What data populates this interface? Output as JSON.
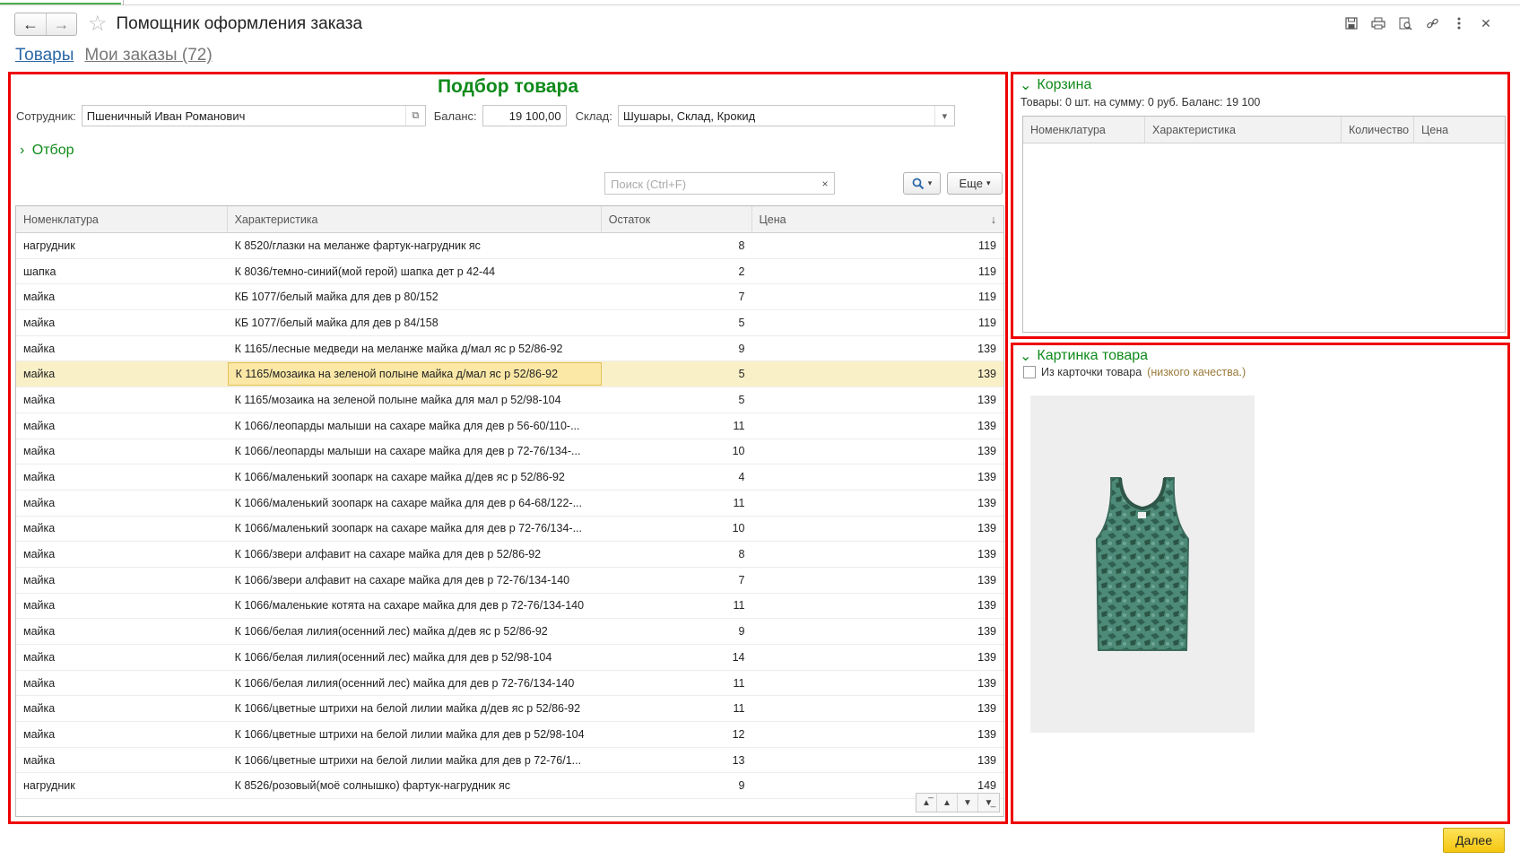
{
  "window": {
    "title": "Помощник оформления заказа",
    "back_icon": "arrow-left-icon",
    "forward_icon": "arrow-right-icon",
    "favorite_icon": "star-icon",
    "tools": [
      "save-icon",
      "print-icon",
      "preview-icon",
      "link-icon",
      "more-vertical-icon",
      "close-icon"
    ]
  },
  "tabs": {
    "products": "Товары",
    "orders": "Мои заказы (72)"
  },
  "selection": {
    "title": "Подбор товара",
    "employee_label": "Сотрудник:",
    "employee_value": "Пшеничный Иван Романович",
    "balance_label": "Баланс:",
    "balance_value": "19 100,00",
    "warehouse_label": "Склад:",
    "warehouse_value": "Шушары, Склад, Крокид",
    "filter_label": "Отбор",
    "search_placeholder": "Поиск (Ctrl+F)",
    "more_label": "Еще",
    "columns": [
      "Номенклатура",
      "Характеристика",
      "Остаток",
      "Цена"
    ],
    "sort_indicator": "↓",
    "rows": [
      {
        "name": "нагрудник",
        "char": "К 8520/глазки на меланже фартук-нагрудник яс",
        "stock": "8",
        "price": "119"
      },
      {
        "name": "шапка",
        "char": "К 8036/темно-синий(мой герой) шапка дет р 42-44",
        "stock": "2",
        "price": "119"
      },
      {
        "name": "майка",
        "char": "КБ 1077/белый майка для дев р 80/152",
        "stock": "7",
        "price": "119"
      },
      {
        "name": "майка",
        "char": "КБ 1077/белый майка для дев р 84/158",
        "stock": "5",
        "price": "119"
      },
      {
        "name": "майка",
        "char": "К 1165/лесные медведи на меланже майка д/мал яс р 52/86-92",
        "stock": "9",
        "price": "139"
      },
      {
        "name": "майка",
        "char": "К 1165/мозаика на зеленой полыне майка д/мал яс р 52/86-92",
        "stock": "5",
        "price": "139",
        "selected": true
      },
      {
        "name": "майка",
        "char": "К 1165/мозаика на зеленой полыне майка для мал р 52/98-104",
        "stock": "5",
        "price": "139"
      },
      {
        "name": "майка",
        "char": "К 1066/леопарды малыши на сахаре майка для дев р 56-60/110-...",
        "stock": "11",
        "price": "139"
      },
      {
        "name": "майка",
        "char": "К 1066/леопарды малыши на сахаре майка для дев р 72-76/134-...",
        "stock": "10",
        "price": "139"
      },
      {
        "name": "майка",
        "char": "К 1066/маленький зоопарк на сахаре майка д/дев яс р 52/86-92",
        "stock": "4",
        "price": "139"
      },
      {
        "name": "майка",
        "char": "К 1066/маленький зоопарк на сахаре майка для дев р 64-68/122-...",
        "stock": "11",
        "price": "139"
      },
      {
        "name": "майка",
        "char": "К 1066/маленький зоопарк на сахаре майка для дев р 72-76/134-...",
        "stock": "10",
        "price": "139"
      },
      {
        "name": "майка",
        "char": "К 1066/звери алфавит на сахаре майка для дев р 52/86-92",
        "stock": "8",
        "price": "139"
      },
      {
        "name": "майка",
        "char": "К 1066/звери алфавит на сахаре майка для дев р 72-76/134-140",
        "stock": "7",
        "price": "139"
      },
      {
        "name": "майка",
        "char": "К 1066/маленькие котята на сахаре майка для дев р 72-76/134-140",
        "stock": "11",
        "price": "139"
      },
      {
        "name": "майка",
        "char": "К 1066/белая лилия(осенний лес) майка д/дев яс р 52/86-92",
        "stock": "9",
        "price": "139"
      },
      {
        "name": "майка",
        "char": "К 1066/белая лилия(осенний лес) майка для дев р 52/98-104",
        "stock": "14",
        "price": "139"
      },
      {
        "name": "майка",
        "char": "К 1066/белая лилия(осенний лес) майка для дев р 72-76/134-140",
        "stock": "11",
        "price": "139"
      },
      {
        "name": "майка",
        "char": "К 1066/цветные штрихи на белой лилии майка д/дев яс р 52/86-92",
        "stock": "11",
        "price": "139"
      },
      {
        "name": "майка",
        "char": "К 1066/цветные штрихи на белой лилии майка для дев р 52/98-104",
        "stock": "12",
        "price": "139"
      },
      {
        "name": "майка",
        "char": "К 1066/цветные штрихи на белой лилии майка для дев р 72-76/1...",
        "stock": "13",
        "price": "139"
      },
      {
        "name": "нагрудник",
        "char": "К 8526/розовый(моё солнышко) фартук-нагрудник яс",
        "stock": "9",
        "price": "149"
      }
    ]
  },
  "cart": {
    "title": "Корзина",
    "summary": "Товары: 0 шт. на сумму: 0 руб. Баланс: 19 100",
    "columns": [
      "Номенклатура",
      "Характеристика",
      "Количество",
      "Цена"
    ]
  },
  "picture": {
    "title": "Картинка товара",
    "checkbox_label": "Из карточки товара",
    "checkbox_hint": "(низкого качества.)"
  },
  "next_button": "Далее",
  "colors": {
    "accent_green": "#0f8a1b",
    "highlight_red": "#e00000",
    "selection": "#faf0c8",
    "primary_button": "#f5c60f"
  }
}
